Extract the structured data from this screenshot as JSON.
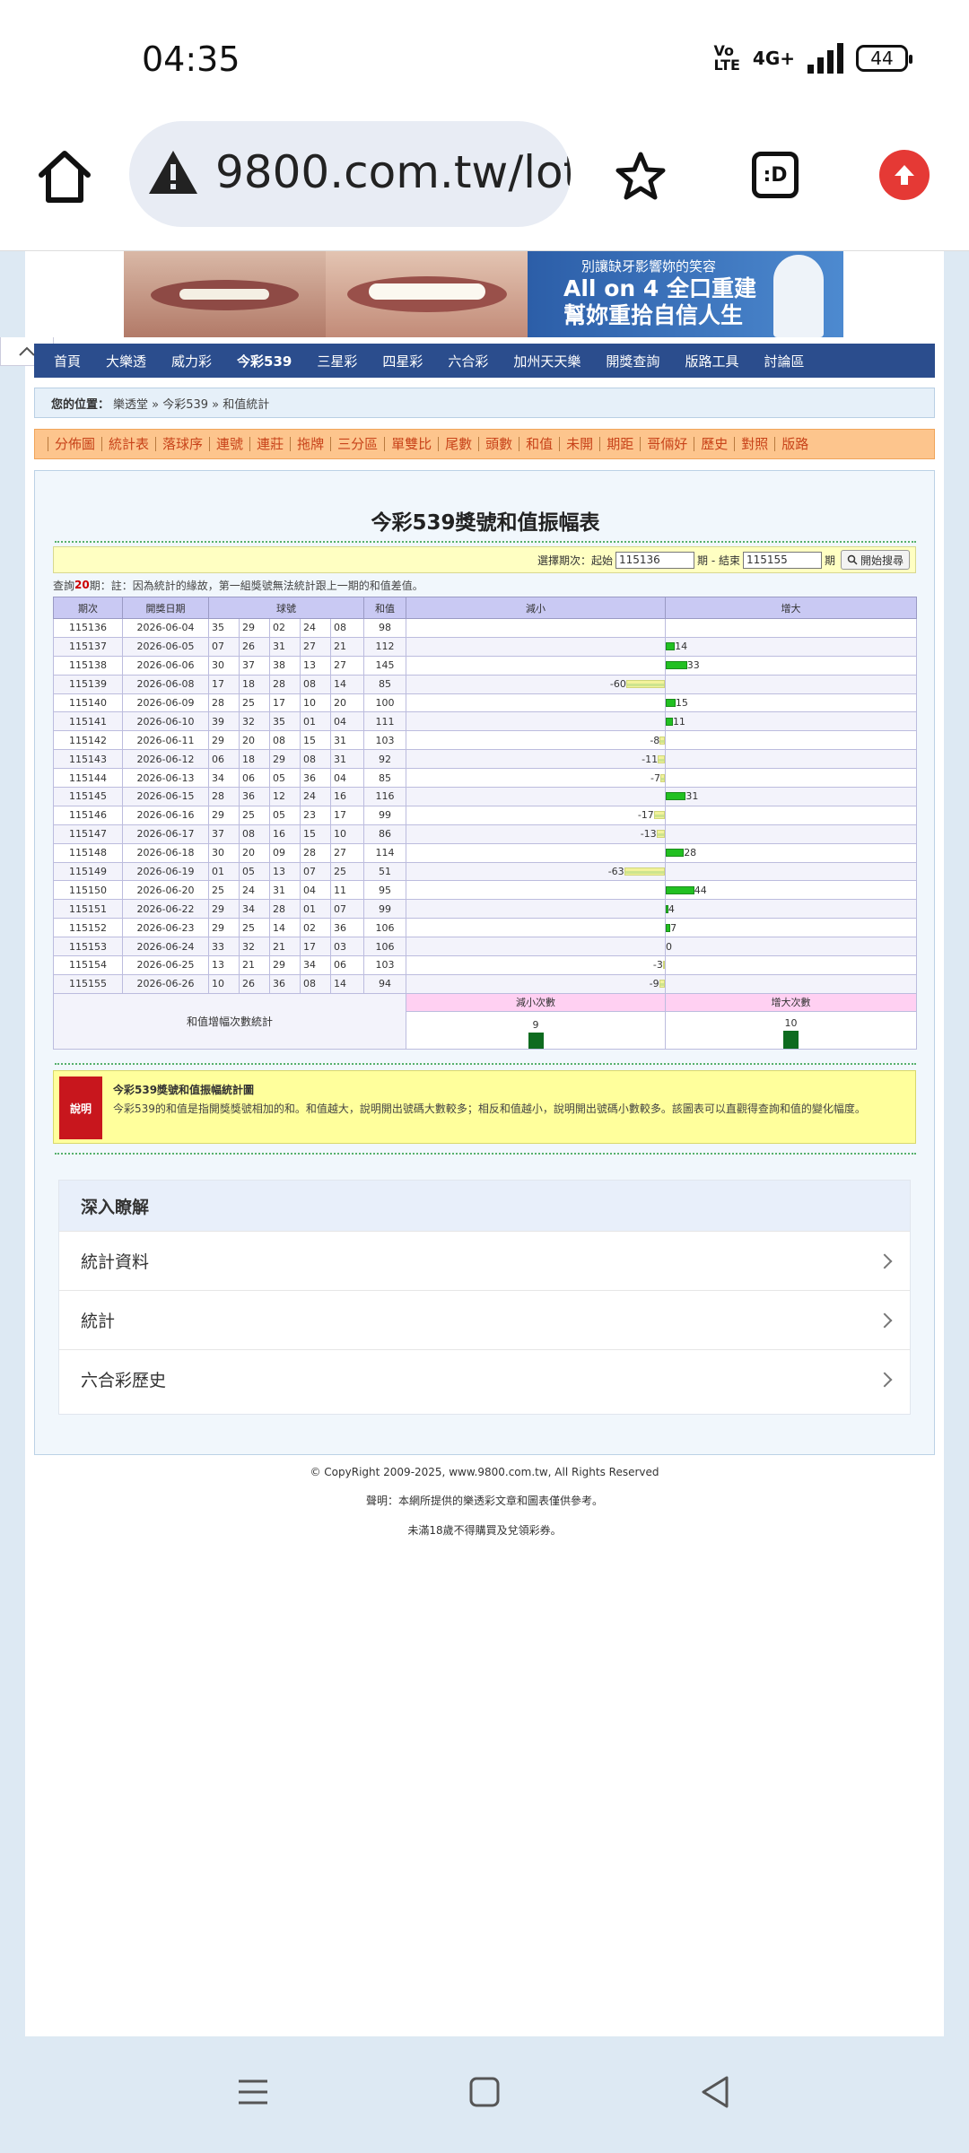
{
  "status": {
    "time": "04:35",
    "volte": "Vo LTE",
    "network": "4G+",
    "battery": "44"
  },
  "browser": {
    "url": "9800.com.tw/lott",
    "tabs_label": ":D"
  },
  "ad": {
    "line1": "別讓缺牙影響妳的笑容",
    "line2": "All on 4 全口重建",
    "line3": "幫妳重拾自信人生"
  },
  "nav": [
    "首頁",
    "大樂透",
    "威力彩",
    "今彩539",
    "三星彩",
    "四星彩",
    "六合彩",
    "加州天天樂",
    "開獎查詢",
    "版路工具",
    "討論區"
  ],
  "breadcrumb": {
    "label": "您的位置：",
    "path": "樂透堂 » 今彩539 » 和值統計"
  },
  "subnav": [
    "分佈圖",
    "統計表",
    "落球序",
    "連號",
    "連莊",
    "拖牌",
    "三分區",
    "單雙比",
    "尾數",
    "頭數",
    "和值",
    "未開",
    "期距",
    "哥倆好",
    "歷史",
    "對照",
    "版路"
  ],
  "title": "今彩539獎號和值振幅表",
  "query": {
    "select_label": "選擇期次：起始",
    "start": "115136",
    "mid": "期 - 結束",
    "end": "115155",
    "suffix": "期",
    "button": "開始搜尋"
  },
  "note": {
    "prefix": "查詢",
    "count": "20",
    "suffix": "期：註：因為統計的緣故，第一組獎號無法統計跟上一期的和值差值。"
  },
  "headers": {
    "period": "期次",
    "date": "開獎日期",
    "balls": "球號",
    "sum": "和值",
    "decrease": "減小",
    "increase": "增大"
  },
  "rows": [
    {
      "period": "115136",
      "date": "2026-06-04",
      "balls": [
        "35",
        "29",
        "02",
        "24",
        "08"
      ],
      "sum": "98",
      "diff": null
    },
    {
      "period": "115137",
      "date": "2026-06-05",
      "balls": [
        "07",
        "26",
        "31",
        "27",
        "21"
      ],
      "sum": "112",
      "diff": 14
    },
    {
      "period": "115138",
      "date": "2026-06-06",
      "balls": [
        "30",
        "37",
        "38",
        "13",
        "27"
      ],
      "sum": "145",
      "diff": 33
    },
    {
      "period": "115139",
      "date": "2026-06-08",
      "balls": [
        "17",
        "18",
        "28",
        "08",
        "14"
      ],
      "sum": "85",
      "diff": -60
    },
    {
      "period": "115140",
      "date": "2026-06-09",
      "balls": [
        "28",
        "25",
        "17",
        "10",
        "20"
      ],
      "sum": "100",
      "diff": 15
    },
    {
      "period": "115141",
      "date": "2026-06-10",
      "balls": [
        "39",
        "32",
        "35",
        "01",
        "04"
      ],
      "sum": "111",
      "diff": 11
    },
    {
      "period": "115142",
      "date": "2026-06-11",
      "balls": [
        "29",
        "20",
        "08",
        "15",
        "31"
      ],
      "sum": "103",
      "diff": -8
    },
    {
      "period": "115143",
      "date": "2026-06-12",
      "balls": [
        "06",
        "18",
        "29",
        "08",
        "31"
      ],
      "sum": "92",
      "diff": -11
    },
    {
      "period": "115144",
      "date": "2026-06-13",
      "balls": [
        "34",
        "06",
        "05",
        "36",
        "04"
      ],
      "sum": "85",
      "diff": -7
    },
    {
      "period": "115145",
      "date": "2026-06-15",
      "balls": [
        "28",
        "36",
        "12",
        "24",
        "16"
      ],
      "sum": "116",
      "diff": 31
    },
    {
      "period": "115146",
      "date": "2026-06-16",
      "balls": [
        "29",
        "25",
        "05",
        "23",
        "17"
      ],
      "sum": "99",
      "diff": -17
    },
    {
      "period": "115147",
      "date": "2026-06-17",
      "balls": [
        "37",
        "08",
        "16",
        "15",
        "10"
      ],
      "sum": "86",
      "diff": -13
    },
    {
      "period": "115148",
      "date": "2026-06-18",
      "balls": [
        "30",
        "20",
        "09",
        "28",
        "27"
      ],
      "sum": "114",
      "diff": 28
    },
    {
      "period": "115149",
      "date": "2026-06-19",
      "balls": [
        "01",
        "05",
        "13",
        "07",
        "25"
      ],
      "sum": "51",
      "diff": -63
    },
    {
      "period": "115150",
      "date": "2026-06-20",
      "balls": [
        "25",
        "24",
        "31",
        "04",
        "11"
      ],
      "sum": "95",
      "diff": 44
    },
    {
      "period": "115151",
      "date": "2026-06-22",
      "balls": [
        "29",
        "34",
        "28",
        "01",
        "07"
      ],
      "sum": "99",
      "diff": 4
    },
    {
      "period": "115152",
      "date": "2026-06-23",
      "balls": [
        "29",
        "25",
        "14",
        "02",
        "36"
      ],
      "sum": "106",
      "diff": 7
    },
    {
      "period": "115153",
      "date": "2026-06-24",
      "balls": [
        "33",
        "32",
        "21",
        "17",
        "03"
      ],
      "sum": "106",
      "diff": 0
    },
    {
      "period": "115154",
      "date": "2026-06-25",
      "balls": [
        "13",
        "21",
        "29",
        "34",
        "06"
      ],
      "sum": "103",
      "diff": -3
    },
    {
      "period": "115155",
      "date": "2026-06-26",
      "balls": [
        "10",
        "26",
        "36",
        "08",
        "14"
      ],
      "sum": "94",
      "diff": -9
    }
  ],
  "summary": {
    "label": "和值增幅次數統計",
    "dec_label": "減小次數",
    "inc_label": "增大次數",
    "dec_count": 9,
    "inc_count": 10
  },
  "desc": {
    "badge": "說明",
    "title": "今彩539獎號和值振幅統計圖",
    "text": "今彩539的和值是指開獎獎號相加的和。和值越大，說明開出號碼大數較多；相反和值越小，說明開出號碼小數較多。該圖表可以直觀得查詢和值的變化幅度。"
  },
  "deep": {
    "title": "深入瞭解",
    "items": [
      "統計資料",
      "統計",
      "六合彩歷史"
    ]
  },
  "footer": {
    "copyright": "© CopyRight 2009-2025, www.9800.com.tw, All Rights Reserved",
    "disclaimer": "聲明：本網所提供的樂透彩文章和圖表僅供參考。",
    "age": "未滿18歲不得購買及兌領彩券。"
  },
  "colors": {
    "nav": "#2b4d8d",
    "subnav": "#fdc58d",
    "increase_bar": "#22c022",
    "decrease_bar": "#e9ef8f",
    "stat_bar": "#0e6b1f",
    "header": "#c9c9f3"
  }
}
